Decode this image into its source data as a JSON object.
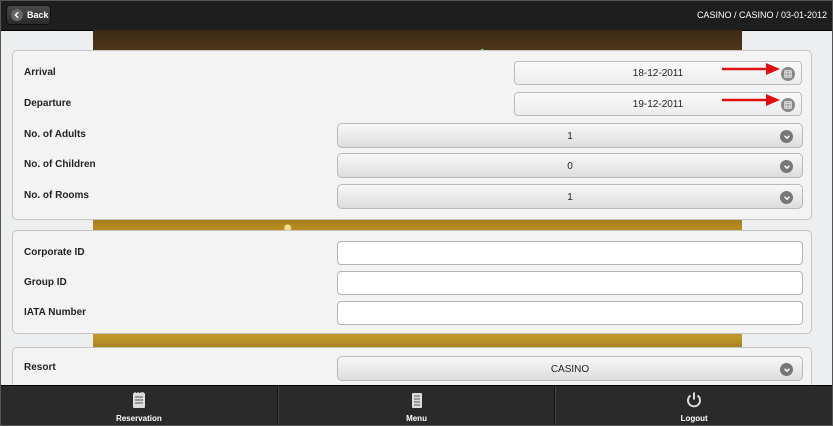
{
  "header": {
    "back_label": "Back",
    "breadcrumb": "CASINO / CASINO / 03-01-2012"
  },
  "stay": {
    "arrival": {
      "label": "Arrival",
      "value": "18-12-2011"
    },
    "departure": {
      "label": "Departure",
      "value": "19-12-2011"
    },
    "adults": {
      "label": "No. of Adults",
      "value": "1"
    },
    "children": {
      "label": "No. of Children",
      "value": "0"
    },
    "rooms": {
      "label": "No. of Rooms",
      "value": "1"
    }
  },
  "codes": {
    "corporate": {
      "label": "Corporate ID",
      "value": ""
    },
    "group": {
      "label": "Group ID",
      "value": ""
    },
    "iata": {
      "label": "IATA Number",
      "value": ""
    }
  },
  "resort": {
    "label": "Resort",
    "value": "CASINO"
  },
  "footer": {
    "tabs": [
      {
        "label": "Reservation",
        "icon": "notepad-icon"
      },
      {
        "label": "Menu",
        "icon": "menu-list-icon"
      },
      {
        "label": "Logout",
        "icon": "power-icon"
      }
    ]
  },
  "colors": {
    "annotation_arrow": "#e01010",
    "header_bg": "#1e1e1e",
    "footer_bg": "#2a2a2a"
  }
}
